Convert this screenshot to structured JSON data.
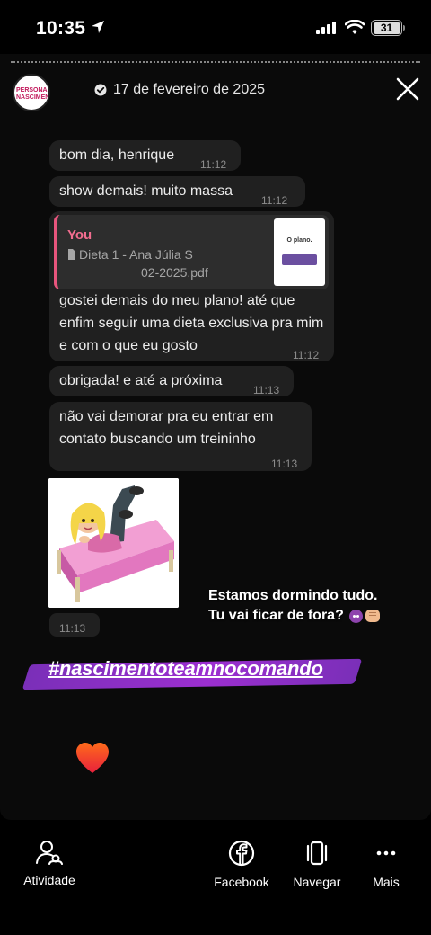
{
  "status_bar": {
    "time": "10:35",
    "battery": "31"
  },
  "story": {
    "date": "17 de fevereiro de 2025",
    "avatar_text": "PERSONAL NASCIMENTO",
    "messages": [
      {
        "text": "bom dia, henrique",
        "time": "11:12"
      },
      {
        "text": "show demais! muito massa",
        "time": "11:12"
      },
      {
        "quote_author": "You",
        "quote_doc_line1": "Dieta 1 - Ana Júlia S",
        "quote_doc_line2": "02-2025.pdf",
        "quote_thumb_title": "O plano.",
        "text": "gostei demais do meu plano! até que enfim seguir uma dieta exclusiva pra mim e com o que eu gosto",
        "time": "11:12"
      },
      {
        "text": "obrigada! e até a próxima",
        "time": "11:13"
      },
      {
        "text": "não vai demorar pra eu entrar em contato buscando um treininho",
        "time": "11:13"
      },
      {
        "text": "",
        "time": "11:13"
      }
    ],
    "caption_line1": "Estamos dormindo tudo.",
    "caption_line2": "Tu vai ficar de fora?",
    "hashtag": "#nascimentoteamnocomando"
  },
  "bottom_nav": [
    {
      "label": "Atividade",
      "icon": "activity-people-icon"
    },
    {
      "label": "Facebook",
      "icon": "facebook-icon"
    },
    {
      "label": "Navegar",
      "icon": "browse-icon"
    },
    {
      "label": "Mais",
      "icon": "more-icon"
    }
  ],
  "colors": {
    "accent_pink": "#f26d8f",
    "hashtag_purple": "#9c2fd0",
    "bubble_bg": "#202020"
  }
}
